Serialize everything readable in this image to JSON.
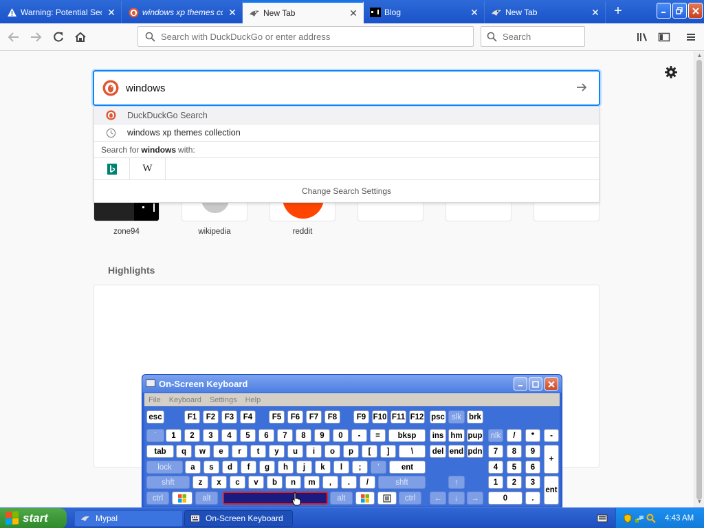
{
  "tabs": [
    {
      "title": "Warning: Potential Secu",
      "icon": "warning-icon",
      "active": false,
      "italic": false
    },
    {
      "title": "windows xp themes colle",
      "icon": "duckduckgo-icon",
      "active": false,
      "italic": true
    },
    {
      "title": "New Tab",
      "icon": "mypal-icon",
      "active": true,
      "italic": false
    },
    {
      "title": "Blog",
      "icon": "zone94-icon",
      "active": false,
      "italic": false
    },
    {
      "title": "New Tab",
      "icon": "mypal-icon",
      "active": false,
      "italic": false
    }
  ],
  "navbar": {
    "url_placeholder": "Search with DuckDuckGo or enter address",
    "search_placeholder": "Search"
  },
  "search": {
    "query": "windows",
    "suggestions": [
      {
        "label": "DuckDuckGo Search",
        "icon": "duckduckgo-icon"
      },
      {
        "label": "windows xp themes collection",
        "icon": "history-clock-icon"
      }
    ],
    "search_for_prefix": "Search for",
    "search_for_term": "windows",
    "search_for_suffix": "with:",
    "engines": [
      "bing-icon",
      "wikipedia-icon"
    ],
    "wikipedia_glyph": "W",
    "change_settings": "Change Search Settings"
  },
  "top_sites": [
    {
      "label": "zone94"
    },
    {
      "label": "wikipedia"
    },
    {
      "label": "reddit"
    },
    {
      "label": ""
    },
    {
      "label": ""
    },
    {
      "label": ""
    }
  ],
  "highlights": {
    "title": "Highlights"
  },
  "osk": {
    "title": "On-Screen Keyboard",
    "menu": [
      "File",
      "Keyboard",
      "Settings",
      "Help"
    ],
    "rows": [
      [
        "esc",
        "F1",
        "F2",
        "F3",
        "F4",
        "F5",
        "F6",
        "F7",
        "F8",
        "F9",
        "F10",
        "F11",
        "F12",
        "psc",
        "slk",
        "brk"
      ],
      [
        "`",
        "1",
        "2",
        "3",
        "4",
        "5",
        "6",
        "7",
        "8",
        "9",
        "0",
        "-",
        "=",
        "bksp",
        "ins",
        "hm",
        "pup",
        "nlk",
        "/",
        "*",
        "-"
      ],
      [
        "tab",
        "q",
        "w",
        "e",
        "r",
        "t",
        "y",
        "u",
        "i",
        "o",
        "p",
        "[",
        "]",
        "\\",
        "del",
        "end",
        "pdn",
        "7",
        "8",
        "9",
        "+"
      ],
      [
        "lock",
        "a",
        "s",
        "d",
        "f",
        "g",
        "h",
        "j",
        "k",
        "l",
        ";",
        "'",
        "ent",
        "4",
        "5",
        "6"
      ],
      [
        "shft",
        "z",
        "x",
        "c",
        "v",
        "b",
        "n",
        "m",
        ",",
        ".",
        "/",
        "shft",
        "↑",
        "1",
        "2",
        "3",
        "ent"
      ],
      [
        "ctrl",
        "alt",
        "alt",
        "ctrl",
        "←",
        "↓",
        "→",
        "0",
        "."
      ]
    ]
  },
  "taskbar": {
    "start_label": "start",
    "buttons": [
      {
        "label": "Mypal"
      },
      {
        "label": "On-Screen Keyboard"
      }
    ],
    "clock": "4:43 AM"
  },
  "colors": {
    "xp_blue": "#2d6ad8",
    "focus_blue": "#0a84ff",
    "duckduckgo_orange": "#de5833",
    "bing_teal": "#008373",
    "reddit_orange": "#ff4500"
  }
}
